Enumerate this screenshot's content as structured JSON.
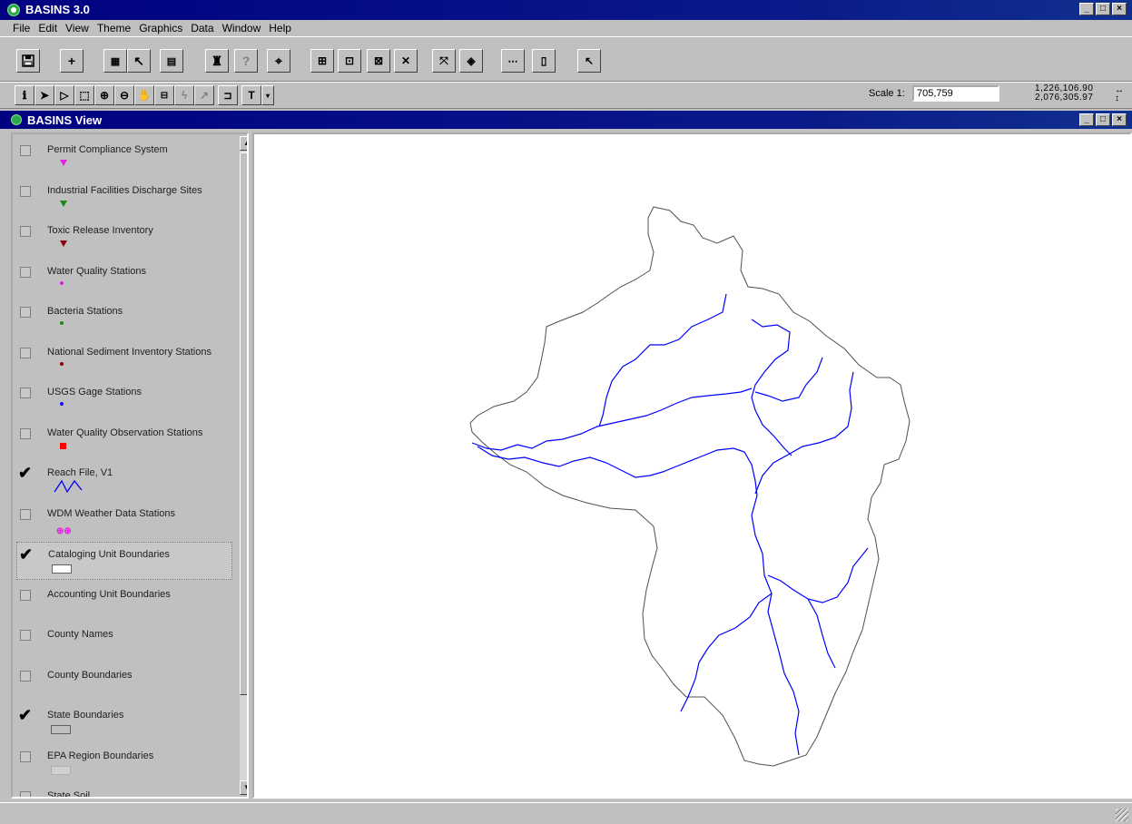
{
  "app": {
    "title": "BASINS 3.0"
  },
  "menu": [
    "File",
    "Edit",
    "View",
    "Theme",
    "Graphics",
    "Data",
    "Window",
    "Help"
  ],
  "toolbar": {
    "scale_label": "Scale 1:",
    "scale_value": "705,759",
    "coord_x": "1,226,106.90",
    "coord_y": "2,076,305.97"
  },
  "view": {
    "title": "BASINS View"
  },
  "legend": [
    {
      "label": "Permit Compliance System",
      "checked": false,
      "symbol": "triangle",
      "color": "#e020e0"
    },
    {
      "label": "Industrial Facilities Discharge Sites",
      "checked": false,
      "symbol": "triangle",
      "color": "#1a8a1a"
    },
    {
      "label": "Toxic Release Inventory",
      "checked": false,
      "symbol": "triangle",
      "color": "#8a0010"
    },
    {
      "label": "Water Quality Stations",
      "checked": false,
      "symbol": "dot",
      "color": "#e020e0"
    },
    {
      "label": "Bacteria Stations",
      "checked": false,
      "symbol": "dot",
      "color": "#1a8a1a"
    },
    {
      "label": "National Sediment Inventory Stations",
      "checked": false,
      "symbol": "dot",
      "color": "#8a0010"
    },
    {
      "label": "USGS Gage Stations",
      "checked": false,
      "symbol": "dot",
      "color": "#1010ff"
    },
    {
      "label": "Water Quality Observation Stations",
      "checked": false,
      "symbol": "square",
      "color": "#ff0000"
    },
    {
      "label": "Reach File, V1",
      "checked": true,
      "symbol": "line",
      "color": "#0000ff"
    },
    {
      "label": "WDM Weather Data Stations",
      "checked": false,
      "symbol": "wdm",
      "color": "#e020e0"
    },
    {
      "label": "Cataloging Unit Boundaries",
      "checked": true,
      "symbol": "box",
      "color": "#ffffff",
      "active": true
    },
    {
      "label": "Accounting Unit Boundaries",
      "checked": false,
      "symbol": "none",
      "color": ""
    },
    {
      "label": "County Names",
      "checked": false,
      "symbol": "none",
      "color": ""
    },
    {
      "label": "County Boundaries",
      "checked": false,
      "symbol": "none",
      "color": ""
    },
    {
      "label": "State Boundaries",
      "checked": true,
      "symbol": "box",
      "color": "#c0c0c0"
    },
    {
      "label": "EPA Region Boundaries",
      "checked": false,
      "symbol": "box-light",
      "color": "#d0d0d0"
    },
    {
      "label": "State Soil",
      "checked": false,
      "symbol": "none",
      "color": ""
    }
  ],
  "map": {
    "boundary_color": "#404040",
    "river_color": "#0000ff",
    "background": "#ffffff"
  }
}
